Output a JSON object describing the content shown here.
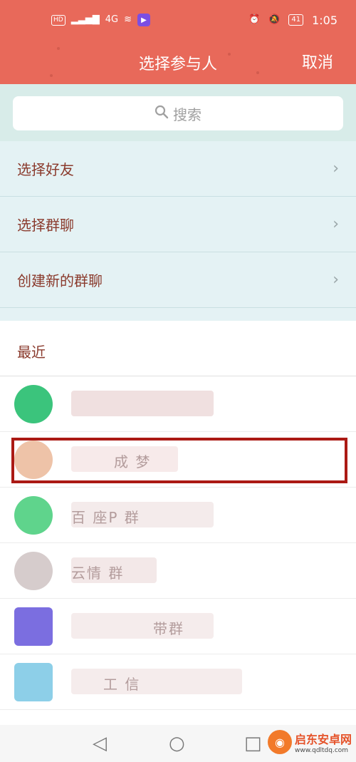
{
  "status_bar": {
    "hd": "HD",
    "network": "4G",
    "time": "1:05",
    "battery": "41"
  },
  "header": {
    "title": "选择参与人",
    "cancel": "取消"
  },
  "search": {
    "placeholder": "搜索"
  },
  "menu": {
    "items": [
      {
        "label": "选择好友"
      },
      {
        "label": "选择群聊"
      },
      {
        "label": "创建新的群聊"
      }
    ]
  },
  "recent": {
    "label": "最近",
    "contacts": [
      {
        "name": "",
        "avatar_color": "#3bc47c"
      },
      {
        "name": "成 梦",
        "avatar_color": "#eec3a8"
      },
      {
        "name": "百 座P 群",
        "avatar_color": "#5fd48c"
      },
      {
        "name": "云情 群",
        "avatar_color": "#d6cccc"
      },
      {
        "name": "带群",
        "avatar_color": "#7b6ee0"
      },
      {
        "name": "工 信",
        "avatar_color": "#8dcfe8"
      }
    ]
  },
  "navbar": {
    "back": "◁",
    "home": "○",
    "recent": "□"
  },
  "watermark": {
    "main": "启东安卓网",
    "sub": "www.qdltdq.com"
  },
  "colors": {
    "header": "#e8695a",
    "highlight": "#ab1a14",
    "menu_bg": "#e4f2f4",
    "text_accent": "#8a3a2c"
  }
}
